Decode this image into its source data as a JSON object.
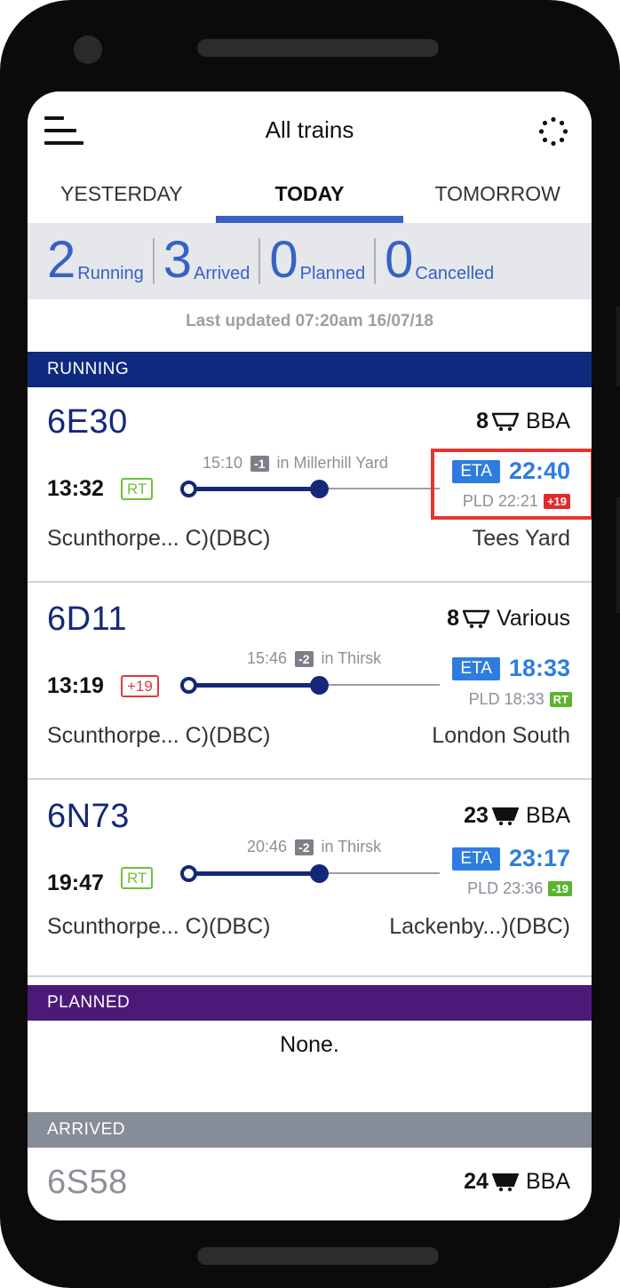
{
  "header": {
    "title": "All trains"
  },
  "tabs": [
    {
      "label": "YESTERDAY"
    },
    {
      "label": "TODAY"
    },
    {
      "label": "TOMORROW"
    }
  ],
  "summary": {
    "running": {
      "count": "2",
      "label": "Running"
    },
    "arrived": {
      "count": "3",
      "label": "Arrived"
    },
    "planned": {
      "count": "0",
      "label": "Planned"
    },
    "cancelled": {
      "count": "0",
      "label": "Cancelled"
    }
  },
  "last_updated": "Last updated 07:20am 16/07/18",
  "sections": {
    "running": "RUNNING",
    "planned": "PLANNED",
    "arrived": "ARRIVED",
    "planned_empty": "None."
  },
  "running_trains": [
    {
      "id": "6E30",
      "wagon_count": "8",
      "wagon_icon": "wagon-outline-icon",
      "wagon_type": "BBA",
      "departure": "13:32",
      "dep_badge": "RT",
      "loc_time": "15:10",
      "loc_delta": "-1",
      "loc_place": "in Millerhill Yard",
      "eta_label": "ETA",
      "eta": "22:40",
      "pld": "PLD 22:21",
      "pld_badge": "+19",
      "from": "Scunthorpe... C)(DBC)",
      "to": "Tees Yard"
    },
    {
      "id": "6D11",
      "wagon_count": "8",
      "wagon_icon": "wagon-outline-icon",
      "wagon_type": "Various",
      "departure": "13:19",
      "dep_badge": "+19",
      "loc_time": "15:46",
      "loc_delta": "-2",
      "loc_place": "in Thirsk",
      "eta_label": "ETA",
      "eta": "18:33",
      "pld": "PLD 18:33",
      "pld_badge": "RT",
      "from": "Scunthorpe... C)(DBC)",
      "to": "London South"
    },
    {
      "id": "6N73",
      "wagon_count": "23",
      "wagon_icon": "wagon-filled-icon",
      "wagon_type": "BBA",
      "departure": "19:47",
      "dep_badge": "RT",
      "loc_time": "20:46",
      "loc_delta": "-2",
      "loc_place": "in Thirsk",
      "eta_label": "ETA",
      "eta": "23:17",
      "pld": "PLD 23:36",
      "pld_badge": "-19",
      "from": "Scunthorpe... C)(DBC)",
      "to": "Lackenby...)(DBC)"
    }
  ],
  "arrived_trains": [
    {
      "id": "6S58",
      "wagon_count": "24",
      "wagon_icon": "wagon-filled-icon",
      "wagon_type": "BBA"
    }
  ],
  "colors": {
    "accent": "#3561c9",
    "running": "#0e2a7e",
    "planned": "#4b1a78",
    "arrived": "#868d98",
    "eta": "#2f7ce0",
    "late": "#e02b2b",
    "ontime": "#5cb32e",
    "highlight": "#e3362f"
  }
}
